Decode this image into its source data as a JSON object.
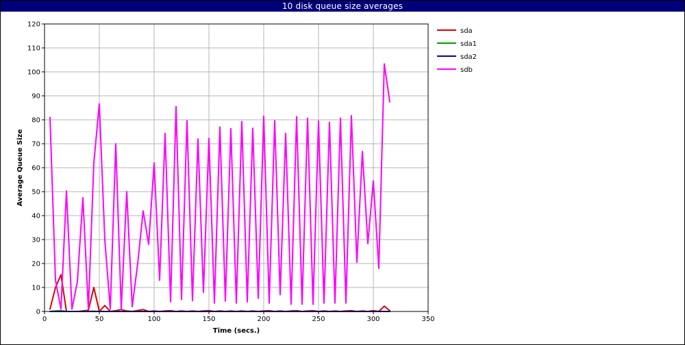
{
  "window": {
    "title": "10 disk queue size averages"
  },
  "chart_data": {
    "type": "line",
    "title": "10 disk queue size averages",
    "xlabel": "Time (secs.)",
    "ylabel": "Average Queue Size",
    "xlim": [
      0,
      350
    ],
    "ylim": [
      0,
      120
    ],
    "xticks": [
      0,
      50,
      100,
      150,
      200,
      250,
      300,
      350
    ],
    "yticks": [
      0,
      10,
      20,
      30,
      40,
      50,
      60,
      70,
      80,
      90,
      100,
      110,
      120
    ],
    "grid": true,
    "legend_position": "right",
    "series": [
      {
        "name": "sda",
        "color": "#dd0000",
        "x": [
          5,
          10,
          15,
          20,
          25,
          30,
          35,
          40,
          45,
          50,
          55,
          60,
          65,
          70,
          75,
          80,
          85,
          90,
          95,
          100,
          105,
          110,
          115,
          120,
          125,
          130,
          135,
          140,
          145,
          150,
          155,
          160,
          165,
          170,
          175,
          180,
          185,
          190,
          195,
          200,
          205,
          210,
          215,
          220,
          225,
          230,
          235,
          240,
          245,
          250,
          255,
          260,
          265,
          270,
          275,
          280,
          285,
          290,
          295,
          300,
          305,
          310,
          315
        ],
        "y": [
          1,
          10,
          15.3,
          0,
          0,
          0,
          0.2,
          0.5,
          10,
          0,
          2.5,
          0,
          0.3,
          0.8,
          0.2,
          0,
          0.4,
          0.8,
          0,
          0.2,
          0,
          0.2,
          0.3,
          0,
          0.2,
          0,
          0.2,
          0,
          0.2,
          0.3,
          0,
          0.2,
          0,
          0.2,
          0,
          0.2,
          0,
          0.2,
          0,
          0.2,
          0.3,
          0,
          0.2,
          0,
          0.2,
          0.3,
          0,
          0.2,
          0.3,
          0,
          0.2,
          0,
          0.2,
          0,
          0.2,
          0.3,
          0,
          0.2,
          0,
          0.3,
          0,
          2.2,
          0.3
        ]
      },
      {
        "name": "sda1",
        "color": "#00a000",
        "x": [
          5,
          10,
          15,
          20,
          25,
          30,
          35,
          40,
          45,
          50,
          60,
          70,
          80,
          90,
          100,
          150,
          200,
          250,
          300,
          315
        ],
        "y": [
          0,
          0.2,
          0.3,
          0,
          0,
          0,
          0,
          0,
          0.1,
          0,
          0,
          0,
          0,
          0,
          0,
          0,
          0,
          0,
          0,
          0
        ]
      },
      {
        "name": "sda2",
        "color": "#0000c0",
        "x": [
          5,
          50,
          100,
          150,
          200,
          250,
          300,
          315
        ],
        "y": [
          0,
          0,
          0,
          0,
          0,
          0,
          0,
          0
        ]
      },
      {
        "name": "sdb",
        "color": "#ff00ff",
        "x": [
          5,
          10,
          15,
          20,
          25,
          30,
          35,
          40,
          45,
          50,
          55,
          60,
          65,
          70,
          75,
          80,
          85,
          90,
          95,
          100,
          105,
          110,
          115,
          120,
          125,
          130,
          135,
          140,
          145,
          150,
          155,
          160,
          165,
          170,
          175,
          180,
          185,
          190,
          195,
          200,
          205,
          210,
          215,
          220,
          225,
          230,
          235,
          240,
          245,
          250,
          255,
          260,
          265,
          270,
          275,
          280,
          285,
          290,
          295,
          300,
          305,
          310,
          315
        ],
        "y": [
          81,
          13,
          1,
          50.3,
          1,
          12.5,
          47.5,
          1,
          62,
          86.7,
          30,
          1,
          70,
          1,
          50,
          2,
          20,
          42,
          28,
          62,
          13,
          74.3,
          4,
          85.5,
          5,
          79.7,
          4.5,
          72,
          8,
          72.3,
          3.5,
          77,
          4.3,
          76.3,
          3.5,
          79.3,
          4,
          76.5,
          5.5,
          81.5,
          3.5,
          79.7,
          7,
          74.3,
          3,
          81.3,
          3,
          80.7,
          3,
          79.5,
          3.5,
          78.9,
          3.5,
          80.7,
          3.5,
          81.7,
          20.5,
          66.8,
          28.3,
          54.5,
          18,
          103.3,
          87.5
        ]
      }
    ]
  }
}
